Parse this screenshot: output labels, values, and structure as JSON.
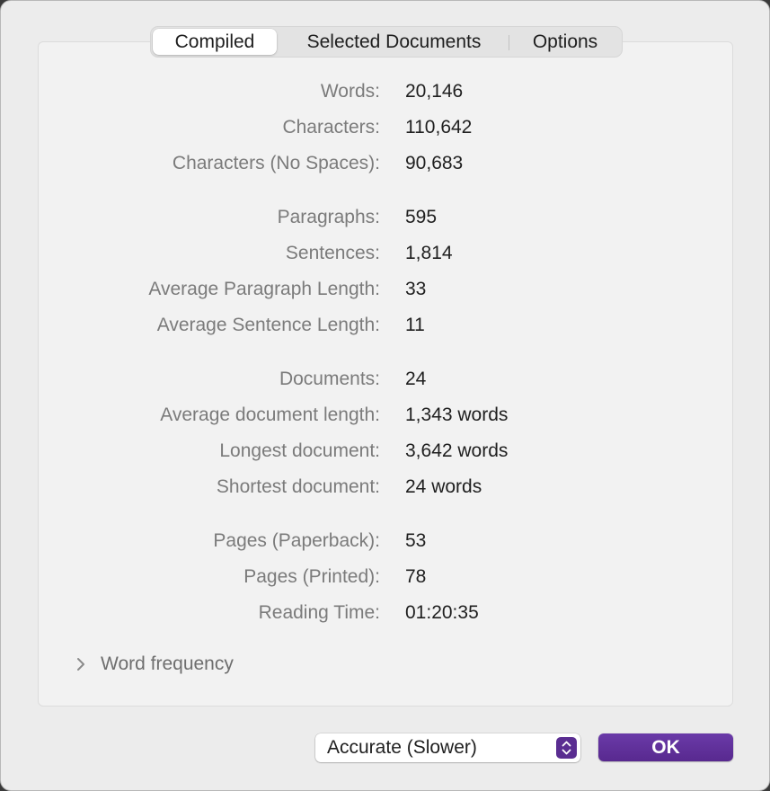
{
  "tabs": [
    {
      "label": "Compiled",
      "selected": true
    },
    {
      "label": "Selected Documents",
      "selected": false
    },
    {
      "label": "Options",
      "selected": false
    }
  ],
  "stats": {
    "words": {
      "label": "Words:",
      "value": "20,146"
    },
    "characters": {
      "label": "Characters:",
      "value": "110,642"
    },
    "characters_no_spaces": {
      "label": "Characters (No Spaces):",
      "value": "90,683"
    },
    "paragraphs": {
      "label": "Paragraphs:",
      "value": "595"
    },
    "sentences": {
      "label": "Sentences:",
      "value": "1,814"
    },
    "avg_paragraph_length": {
      "label": "Average Paragraph Length:",
      "value": "33"
    },
    "avg_sentence_length": {
      "label": "Average Sentence Length:",
      "value": "11"
    },
    "documents": {
      "label": "Documents:",
      "value": "24"
    },
    "avg_document_length": {
      "label": "Average document length:",
      "value": "1,343 words"
    },
    "longest_document": {
      "label": "Longest document:",
      "value": "3,642 words"
    },
    "shortest_document": {
      "label": "Shortest document:",
      "value": "24 words"
    },
    "pages_paperback": {
      "label": "Pages (Paperback):",
      "value": "53"
    },
    "pages_printed": {
      "label": "Pages (Printed):",
      "value": "78"
    },
    "reading_time": {
      "label": "Reading Time:",
      "value": "01:20:35"
    }
  },
  "word_frequency": {
    "label": "Word frequency",
    "icon": "chevron-right-icon",
    "expanded": false
  },
  "accuracy_popup": {
    "selected": "Accurate (Slower)",
    "icon": "up-down-chevron-icon"
  },
  "ok_button": {
    "label": "OK"
  },
  "colors": {
    "accent": "#5a2d91",
    "label_gray": "#7b7b7b",
    "value_text": "#1f1f1f",
    "panel_bg": "#f2f2f2",
    "window_bg": "#ececec"
  }
}
